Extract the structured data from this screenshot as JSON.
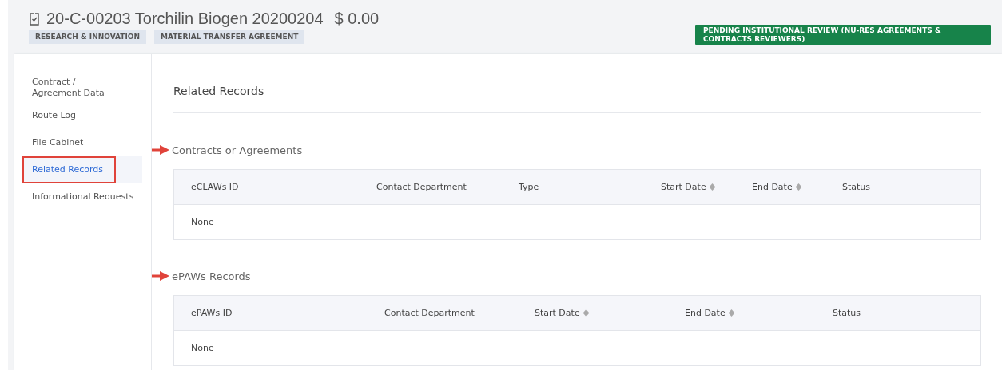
{
  "header": {
    "title": "20-C-00203 Torchilin Biogen 20200204",
    "amount": "$ 0.00",
    "tags": [
      "RESEARCH & INNOVATION",
      "MATERIAL TRANSFER AGREEMENT"
    ],
    "status": "PENDING INSTITUTIONAL REVIEW (NU-RES AGREEMENTS & CONTRACTS REVIEWERS)"
  },
  "sidebar": {
    "items": [
      {
        "label": "Contract / Agreement Data",
        "selected": false,
        "highlighted": false
      },
      {
        "label": "Route Log",
        "selected": false,
        "highlighted": false
      },
      {
        "label": "File Cabinet",
        "selected": false,
        "highlighted": false
      },
      {
        "label": "Related Records",
        "selected": true,
        "highlighted": true
      },
      {
        "label": "Informational Requests",
        "selected": false,
        "highlighted": false
      }
    ]
  },
  "content": {
    "title": "Related Records",
    "sections": [
      {
        "title": "Contracts or Agreements",
        "columns": [
          {
            "label": "eCLAWs ID",
            "sortable": false
          },
          {
            "label": "Contact Department",
            "sortable": false
          },
          {
            "label": "Type",
            "sortable": false
          },
          {
            "label": "Start Date",
            "sortable": true
          },
          {
            "label": "End Date",
            "sortable": true
          },
          {
            "label": "Status",
            "sortable": false
          }
        ],
        "rows": [
          [
            "None"
          ]
        ]
      },
      {
        "title": "ePAWs Records",
        "columns": [
          {
            "label": "ePAWs ID",
            "sortable": false
          },
          {
            "label": "Contact Department",
            "sortable": false
          },
          {
            "label": "Start Date",
            "sortable": true
          },
          {
            "label": "End Date",
            "sortable": true
          },
          {
            "label": "Status",
            "sortable": false
          }
        ],
        "rows": [
          [
            "None"
          ]
        ]
      }
    ]
  }
}
